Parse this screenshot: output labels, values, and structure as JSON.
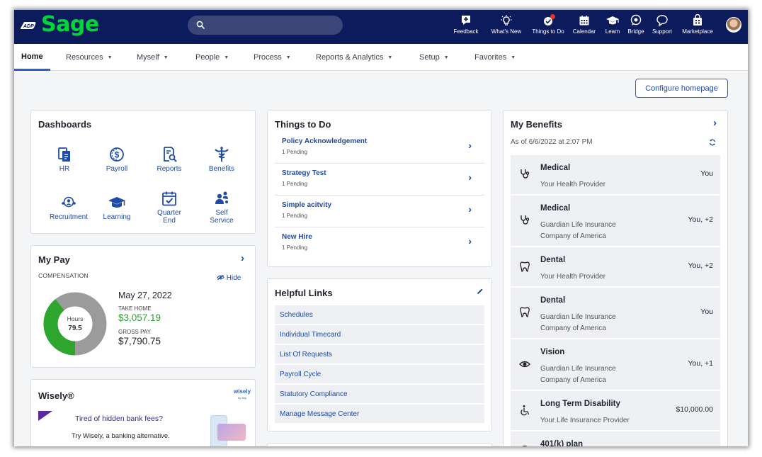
{
  "topbar": {
    "brand": "Sage",
    "items": [
      {
        "label": "Feedback",
        "icon": "feedback-icon"
      },
      {
        "label": "What's New",
        "icon": "lightbulb-icon"
      },
      {
        "label": "Things to Do",
        "icon": "things-to-do-icon"
      },
      {
        "label": "Calendar",
        "icon": "calendar-icon"
      },
      {
        "label": "Learn",
        "icon": "graduation-cap-icon"
      },
      {
        "label": "Bridge",
        "icon": "bridge-chat-icon"
      },
      {
        "label": "Support",
        "icon": "support-chat-icon"
      },
      {
        "label": "Marketplace",
        "icon": "marketplace-icon"
      }
    ],
    "colors": {
      "bar": "#0b1b5c",
      "brand": "#00d639",
      "badge": "#e5332a"
    }
  },
  "nav": {
    "items": [
      {
        "label": "Home",
        "dropdown": false
      },
      {
        "label": "Resources",
        "dropdown": true
      },
      {
        "label": "Myself",
        "dropdown": true
      },
      {
        "label": "People",
        "dropdown": true
      },
      {
        "label": "Process",
        "dropdown": true
      },
      {
        "label": "Reports & Analytics",
        "dropdown": true
      },
      {
        "label": "Setup",
        "dropdown": true
      },
      {
        "label": "Favorites",
        "dropdown": true
      }
    ],
    "caret": "▼"
  },
  "configure_button": "Configure homepage",
  "dashboards": {
    "title": "Dashboards",
    "tiles": [
      {
        "label": "HR",
        "icon": "hr-documents-icon"
      },
      {
        "label": "Payroll",
        "icon": "payroll-coin-icon"
      },
      {
        "label": "Reports",
        "icon": "reports-magnifier-icon"
      },
      {
        "label": "Benefits",
        "icon": "benefits-caduceus-icon"
      },
      {
        "label": "Recruitment",
        "icon": "recruitment-people-icon"
      },
      {
        "label": "Learning",
        "icon": "graduation-cap-icon"
      },
      {
        "label": "Quarter End",
        "icon": "calendar-check-icon"
      },
      {
        "label": "Self Service",
        "icon": "self-service-people-icon"
      }
    ]
  },
  "my_pay": {
    "title": "My Pay",
    "compensation_label": "COMPENSATION",
    "hide_label": "Hide",
    "date": "May 27, 2022",
    "take_home_label": "TAKE HOME",
    "take_home": "$3,057.19",
    "gross_label": "GROSS PAY",
    "gross": "$7,790.75",
    "hours_label": "Hours",
    "hours": "79.5",
    "donut_take_home_fraction": 0.392,
    "colors": {
      "take_home": "#2ea52d",
      "remaining": "#9b9b9b"
    }
  },
  "wisely": {
    "title": "Wisely®",
    "logo": "wisely",
    "logo_sub": "by adp",
    "headline": "Tired of hidden bank fees?",
    "body": "Try Wisely, a banking alternative."
  },
  "things_to_do": {
    "title": "Things to Do",
    "items": [
      {
        "title": "Policy Acknowledgement",
        "status": "1 Pending"
      },
      {
        "title": "Strategy Test",
        "status": "1 Pending"
      },
      {
        "title": "Simple acitvity",
        "status": "1 Pending"
      },
      {
        "title": "New Hire",
        "status": "1 Pending"
      }
    ]
  },
  "helpful_links": {
    "title": "Helpful Links",
    "links": [
      "Schedules",
      "Individual Timecard",
      "List Of Requests",
      "Payroll Cycle",
      "Statutory Compliance",
      "Manage Message Center"
    ]
  },
  "benefits": {
    "title": "My Benefits",
    "as_of": "As of 6/6/2022 at 2:07 PM",
    "items": [
      {
        "name": "Medical",
        "provider": [
          "Your Health Provider"
        ],
        "coverage": "You",
        "icon": "stethoscope-icon"
      },
      {
        "name": "Medical",
        "provider": [
          "Guardian Life Insurance",
          "Company of America"
        ],
        "coverage": "You, +2",
        "icon": "stethoscope-icon"
      },
      {
        "name": "Dental",
        "provider": [
          "Your Health Provider"
        ],
        "coverage": "You, +2",
        "icon": "tooth-icon"
      },
      {
        "name": "Dental",
        "provider": [
          "Guardian Life Insurance",
          "Company of America"
        ],
        "coverage": "You",
        "icon": "tooth-icon"
      },
      {
        "name": "Vision",
        "provider": [
          "Guardian Life Insurance",
          "Company of America"
        ],
        "coverage": "You, +1",
        "icon": "eye-icon"
      },
      {
        "name": "Long Term Disability",
        "provider": [
          "Your Life Insurance Provider"
        ],
        "coverage": "$10,000.00",
        "icon": "wheelchair-icon"
      },
      {
        "name": "401(k) plan",
        "provider": [],
        "coverage": "",
        "icon": "plan-icon"
      }
    ]
  }
}
